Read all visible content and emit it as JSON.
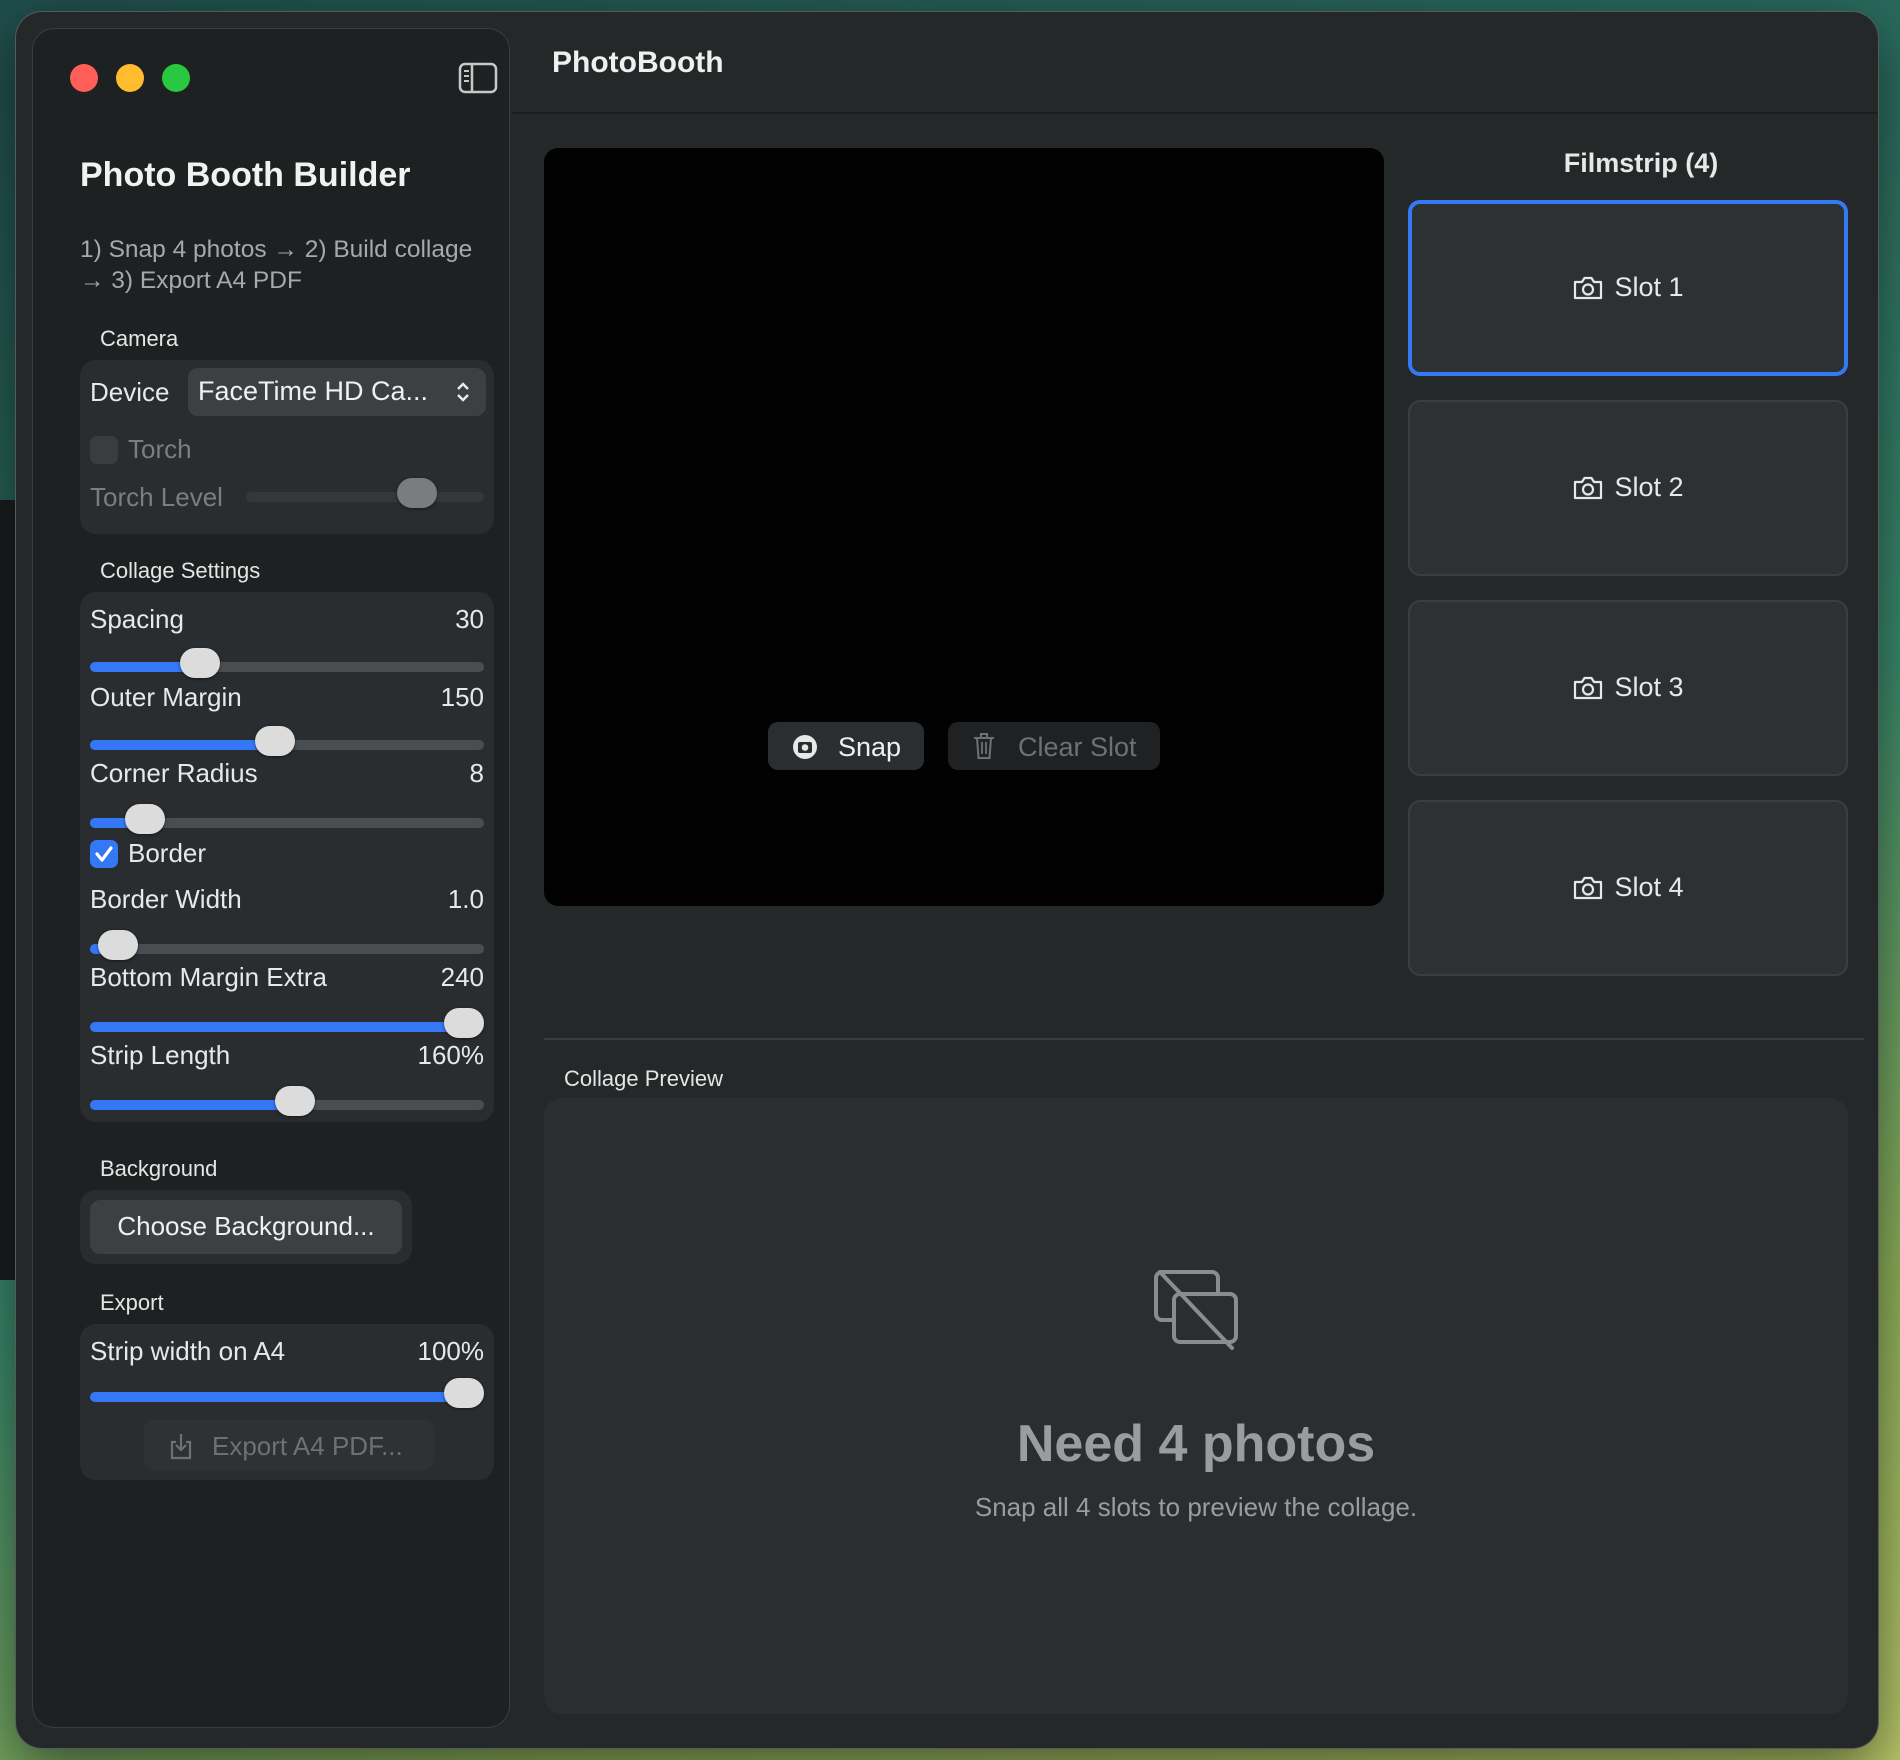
{
  "window": {
    "title": "PhotoBooth"
  },
  "sidebar": {
    "title": "Photo Booth Builder",
    "subtitle": "1) Snap 4 photos → 2) Build collage → 3) Export A4 PDF",
    "camera": {
      "header": "Camera",
      "device_label": "Device",
      "device_value": "FaceTime HD Ca...",
      "torch_label": "Torch",
      "torch_checked": false,
      "torch_level_label": "Torch Level",
      "torch_level_fraction": 0.72
    },
    "collage": {
      "header": "Collage Settings",
      "spacing": {
        "label": "Spacing",
        "value": "30",
        "fraction": 0.28
      },
      "outer_margin": {
        "label": "Outer Margin",
        "value": "150",
        "fraction": 0.47
      },
      "corner_radius": {
        "label": "Corner Radius",
        "value": "8",
        "fraction": 0.14
      },
      "border": {
        "label": "Border",
        "checked": true
      },
      "border_width": {
        "label": "Border Width",
        "value": "1.0",
        "fraction": 0.07
      },
      "bottom_margin_extra": {
        "label": "Bottom Margin Extra",
        "value": "240",
        "fraction": 0.95
      },
      "strip_length": {
        "label": "Strip Length",
        "value": "160%",
        "fraction": 0.52
      }
    },
    "background": {
      "header": "Background",
      "choose_button": "Choose Background..."
    },
    "export": {
      "header": "Export",
      "strip_width": {
        "label": "Strip width on A4",
        "value": "100%",
        "fraction": 0.95
      },
      "export_button": "Export A4 PDF..."
    }
  },
  "camera_view": {
    "snap_button": "Snap",
    "clear_slot_button": "Clear Slot"
  },
  "filmstrip": {
    "title": "Filmstrip (4)",
    "slots": [
      {
        "label": "Slot 1",
        "selected": true
      },
      {
        "label": "Slot 2",
        "selected": false
      },
      {
        "label": "Slot 3",
        "selected": false
      },
      {
        "label": "Slot 4",
        "selected": false
      }
    ]
  },
  "preview": {
    "label": "Collage Preview",
    "empty_title": "Need 4 photos",
    "empty_subtitle": "Snap all 4 slots to preview the collage."
  },
  "colors": {
    "accent": "#3478f6",
    "window_bg": "#252829",
    "sidebar_bg": "#1e2122"
  },
  "icons": [
    "sidebar-toggle-icon",
    "chevron-updown-icon",
    "checkmark-icon",
    "export-icon",
    "camera-icon",
    "trash-icon",
    "no-photos-icon"
  ]
}
